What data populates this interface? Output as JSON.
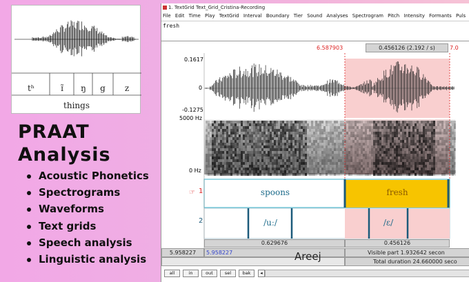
{
  "inset": {
    "segments": [
      "tʰ",
      "ɪ̃",
      "ŋ",
      "g",
      "z"
    ],
    "word": "things"
  },
  "promo": {
    "title_line1": "PRAAT",
    "title_line2": "Analysis",
    "bullets": [
      "Acoustic Phonetics",
      "Spectrograms",
      "Waveforms",
      "Text grids",
      "Speech analysis",
      "Linguistic analysis"
    ]
  },
  "window": {
    "title": "1. TextGrid Text_Grid_Cristina-Recording",
    "menu": [
      "File",
      "Edit",
      "Time",
      "Play",
      "TextGrid",
      "Interval",
      "Boundary",
      "Tier",
      "Sound",
      "Analyses",
      "Spectrogram",
      "Pitch",
      "Intensity",
      "Formants",
      "Puls"
    ],
    "text_field": "fresh",
    "cursor_time": "6.587903",
    "selection_duration": "0.456126 (2.192 / s)",
    "right_time_fragment": "7.0",
    "waveform": {
      "max": "0.1617",
      "zero": "0",
      "min": "-0.1275"
    },
    "spectrogram": {
      "top": "5000 Hz",
      "bottom": "0 Hz"
    },
    "tier1": {
      "number": "1",
      "pointer_icon": "tier-pointer-icon",
      "intervals": [
        "spoons",
        "fresh"
      ]
    },
    "tier2": {
      "number": "2",
      "intervals": [
        "/uː/",
        "/ɛ/"
      ]
    },
    "durations": [
      "0.629676",
      "0.456126"
    ],
    "bottom": {
      "left_time": "5.958227",
      "visible_start": "5.958227",
      "watermark": "Areej",
      "visible_part": "Visible part 1.932642 secon",
      "total_duration": "Total duration 24.660000 seco"
    },
    "buttons": [
      "all",
      "in",
      "out",
      "sel",
      "bak"
    ],
    "colors": {
      "selection": "#f9cfcf",
      "highlight": "#f7c400",
      "tier_boundary": "#1b5a7a",
      "time_red": "#dd2222"
    }
  }
}
